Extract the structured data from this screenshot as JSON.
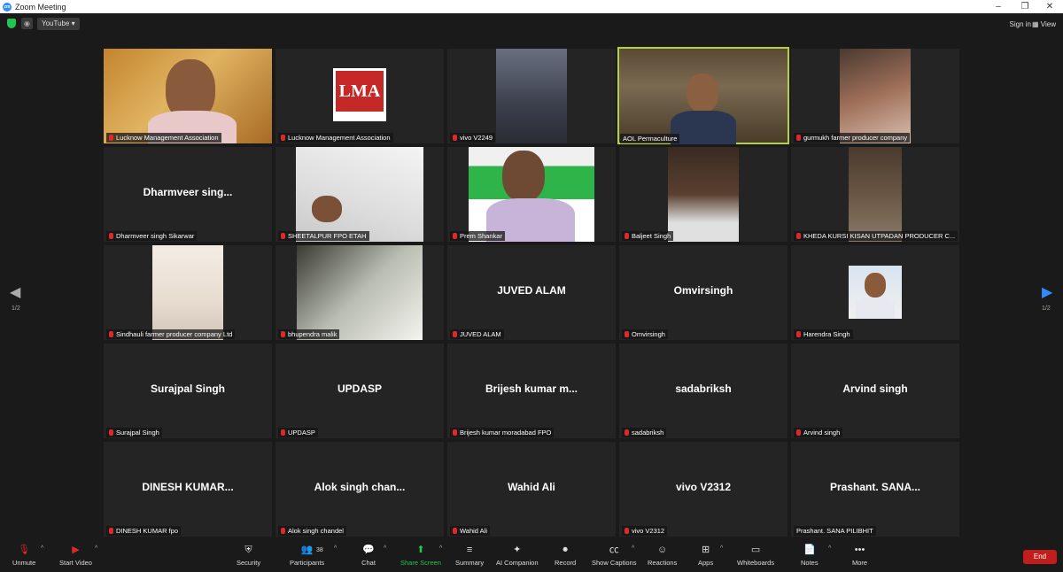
{
  "window": {
    "title": "Zoom Meeting",
    "app_icon": "zm"
  },
  "topbar": {
    "stream_target": "YouTube",
    "signin": "Sign in",
    "view": "View"
  },
  "pagination": {
    "left": "1/2",
    "right": "1/2"
  },
  "tiles": [
    {
      "label": "Lucknow Management Association",
      "big": ""
    },
    {
      "label": "Lucknow Management Association",
      "big": ""
    },
    {
      "label": "vivo V2249",
      "big": ""
    },
    {
      "label": "AOL Permaculture",
      "big": ""
    },
    {
      "label": "gurmukh farmer producer company",
      "big": ""
    },
    {
      "label": "Dharmveer singh Sikarwar",
      "big": "Dharmveer sing..."
    },
    {
      "label": "SHEETALPUR FPO ETAH",
      "big": ""
    },
    {
      "label": "Prem Shankar",
      "big": ""
    },
    {
      "label": "Baljeet Singh",
      "big": ""
    },
    {
      "label": "KHEDA KURSI KISAN UTPADAN PRODUCER C...",
      "big": ""
    },
    {
      "label": "Sindhauli farmer producer company Ltd",
      "big": ""
    },
    {
      "label": "bhupendra malik",
      "big": ""
    },
    {
      "label": "JUVED ALAM",
      "big": "JUVED ALAM"
    },
    {
      "label": "Omvirsingh",
      "big": "Omvirsingh"
    },
    {
      "label": "Harendra Singh",
      "big": ""
    },
    {
      "label": "Surajpal Singh",
      "big": "Surajpal Singh"
    },
    {
      "label": "UPDASP",
      "big": "UPDASP"
    },
    {
      "label": "Brijesh kumar moradabad FPO",
      "big": "Brijesh kumar m..."
    },
    {
      "label": "sadabriksh",
      "big": "sadabriksh"
    },
    {
      "label": "Arvind singh",
      "big": "Arvind singh"
    },
    {
      "label": "DINESH KUMAR fpo",
      "big": "DINESH  KUMAR..."
    },
    {
      "label": "Alok singh chandel",
      "big": "Alok singh chan..."
    },
    {
      "label": "Wahid Ali",
      "big": "Wahid Ali"
    },
    {
      "label": "vivo V2312",
      "big": "vivo V2312"
    },
    {
      "label": "Prashant. SANA PILIBHIT",
      "big": "Prashant. SANA..."
    }
  ],
  "logo_text": "LMA",
  "toolbar": {
    "unmute": "Unmute",
    "start_video": "Start Video",
    "security": "Security",
    "participants": "Participants",
    "participants_count": "38",
    "chat": "Chat",
    "share_screen": "Share Screen",
    "summary": "Summary",
    "ai_companion": "AI Companion",
    "record": "Record",
    "show_captions": "Show Captions",
    "reactions": "Reactions",
    "apps": "Apps",
    "whiteboards": "Whiteboards",
    "notes": "Notes",
    "more": "More",
    "end": "End"
  },
  "colors": {
    "active_speaker": "#b4d143",
    "share_green": "#23c552",
    "end_red": "#c21d1d",
    "muted_red": "#e02828"
  }
}
